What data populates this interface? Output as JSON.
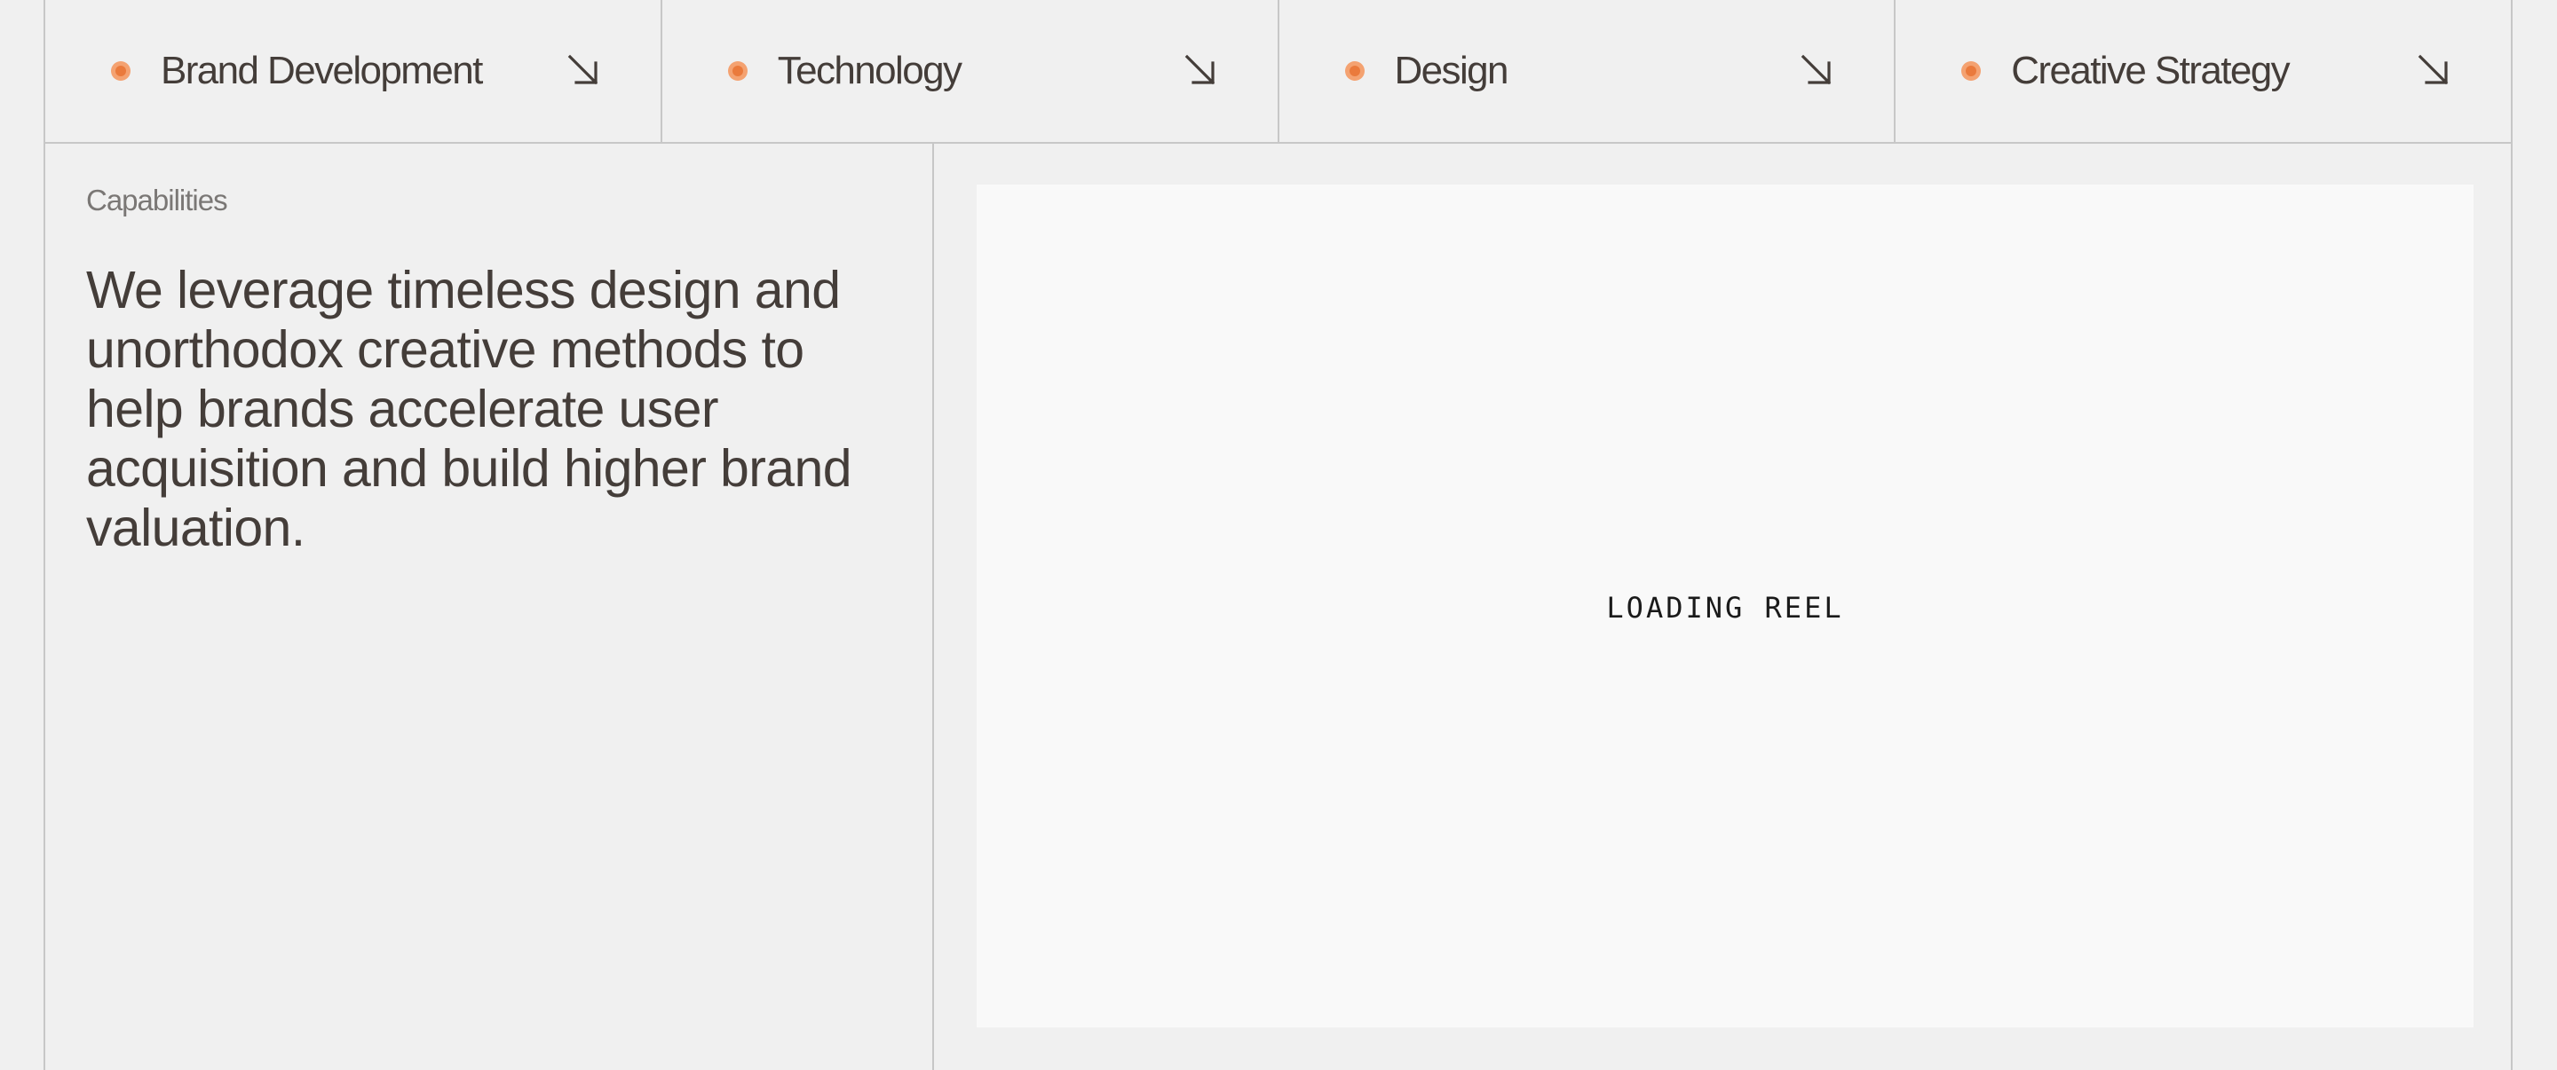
{
  "tabs": [
    {
      "label": "Brand Development",
      "icon": "arrow-down-right-icon"
    },
    {
      "label": "Technology",
      "icon": "arrow-down-right-icon"
    },
    {
      "label": "Design",
      "icon": "arrow-down-right-icon"
    },
    {
      "label": "Creative Strategy",
      "icon": "arrow-down-right-icon"
    }
  ],
  "capabilities": {
    "label": "Capabilities",
    "headline": "We leverage timeless design and unorthodox creative methods to help brands accelerate user acquisition and build higher brand valuation."
  },
  "reel": {
    "status": "LOADING REEL"
  },
  "colors": {
    "accent": "#ea7a3c",
    "accent_light": "#f4a271",
    "text": "#443d39",
    "muted": "#7a7775",
    "background": "#f0f0f0",
    "panel": "#f9f9f9",
    "border": "#c7c7c7"
  }
}
